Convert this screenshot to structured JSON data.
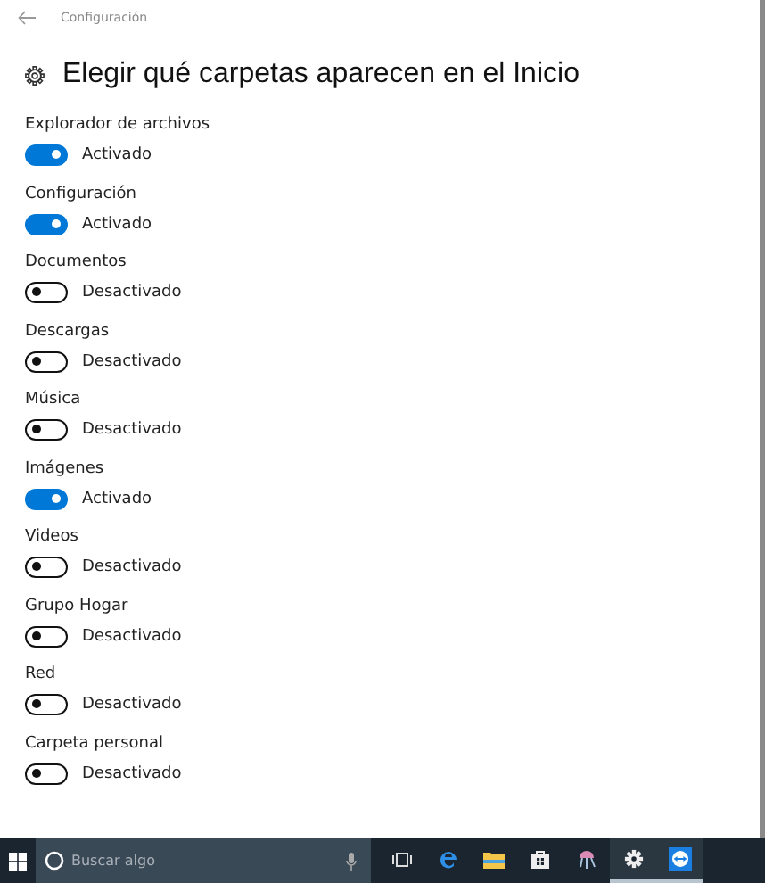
{
  "window": {
    "title": "Configuración"
  },
  "heading": "Elegir qué carpetas aparecen en el Inicio",
  "settings": [
    {
      "label": "Explorador de archivos",
      "on": true,
      "state": "Activado"
    },
    {
      "label": "Configuración",
      "on": true,
      "state": "Activado"
    },
    {
      "label": "Documentos",
      "on": false,
      "state": "Desactivado"
    },
    {
      "label": "Descargas",
      "on": false,
      "state": "Desactivado"
    },
    {
      "label": "Música",
      "on": false,
      "state": "Desactivado"
    },
    {
      "label": "Imágenes",
      "on": true,
      "state": "Activado"
    },
    {
      "label": "Videos",
      "on": false,
      "state": "Desactivado"
    },
    {
      "label": "Grupo Hogar",
      "on": false,
      "state": "Desactivado"
    },
    {
      "label": "Red",
      "on": false,
      "state": "Desactivado"
    },
    {
      "label": "Carpeta personal",
      "on": false,
      "state": "Desactivado"
    }
  ],
  "taskbar": {
    "search": {
      "placeholder": "Buscar algo"
    },
    "apps": [
      {
        "kind": "taskview",
        "active": false
      },
      {
        "kind": "edge",
        "active": false
      },
      {
        "kind": "explorer",
        "active": false
      },
      {
        "kind": "store",
        "active": false
      },
      {
        "kind": "jellyfish",
        "active": false
      },
      {
        "kind": "settings",
        "active": true
      },
      {
        "kind": "teamviewer",
        "active": true
      }
    ]
  }
}
